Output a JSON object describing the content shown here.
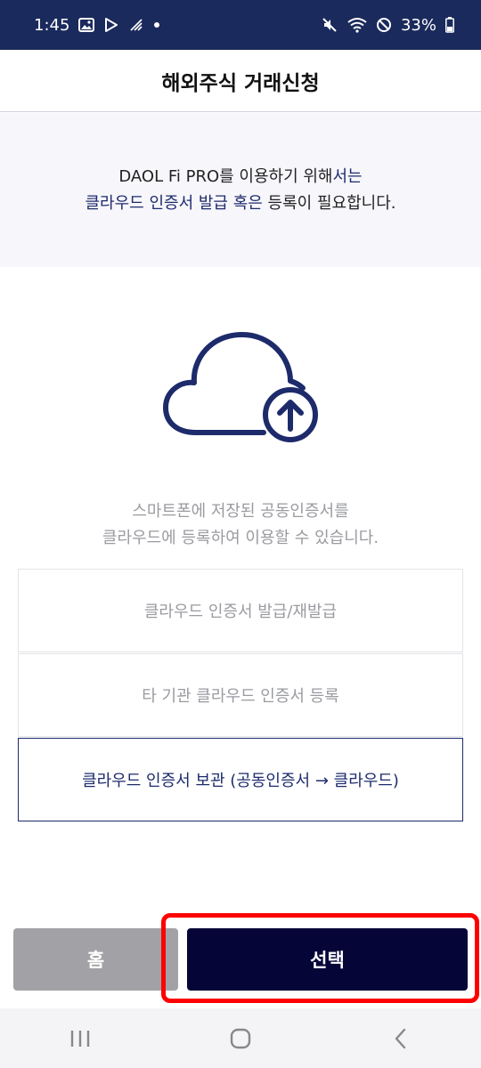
{
  "status_bar": {
    "time": "1:45",
    "battery": "33%",
    "left_icons": [
      "gallery-icon",
      "play-store-icon",
      "signal-activity-icon",
      "dot-icon"
    ],
    "right_icons": [
      "mute-icon",
      "wifi-icon",
      "do-not-disturb-icon",
      "battery-icon"
    ]
  },
  "header": {
    "title": "해외주식 거래신청"
  },
  "banner": {
    "line1_prefix": "DAOL Fi PRO를 이용하기 위해",
    "line1_accent": "서는",
    "line2_accent": "클라우드 인증서 발급 혹은",
    "line2_suffix": " 등록이 필요합니다."
  },
  "illustration": {
    "icon": "cloud-upload-icon",
    "color": "#1d2b6b"
  },
  "description": {
    "line1": "스마트폰에 저장된 공동인증서를",
    "line2": "클라우드에 등록하여 이용할 수 있습니다."
  },
  "options": [
    {
      "label": "클라우드 인증서 발급/재발급",
      "selected": false
    },
    {
      "label": "타 기관 클라우드 인증서 등록",
      "selected": false
    },
    {
      "label": "클라우드 인증서 보관 (공동인증서 → 클라우드)",
      "selected": true
    }
  ],
  "buttons": {
    "home": "홈",
    "select": "선택"
  },
  "nav_bar": {
    "icons": [
      "recent-apps-icon",
      "home-icon",
      "back-icon"
    ]
  },
  "colors": {
    "status_bar": "#1b2a5c",
    "accent": "#1d2b6b",
    "select_button": "#050537",
    "home_button": "#a2a2a6",
    "highlight": "#ff0000"
  }
}
